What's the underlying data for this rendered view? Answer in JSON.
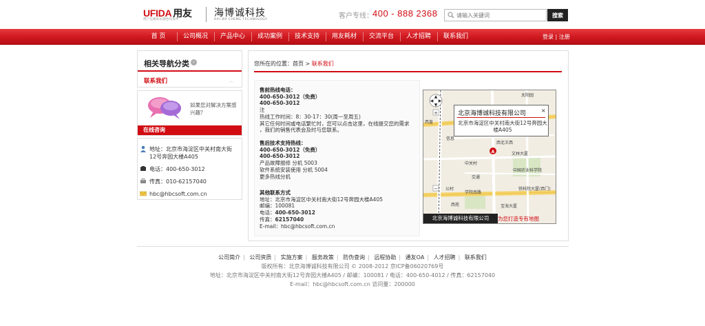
{
  "header": {
    "ufida_brand": "UFIDA",
    "ufida_cn": "用友",
    "ufida_slogan": "用户信赖的长期合作伙伴",
    "hbc_name": "海博诚科技",
    "hbc_sub": "HAI BO CHENG TECHNOLOGY",
    "hotline_label": "客户专线：",
    "hotline_number": "400 - 888 2368",
    "search_placeholder": "请输入关键词",
    "search_button": "搜索"
  },
  "nav": {
    "items": [
      "首 页",
      "公司概况",
      "产品中心",
      "成功案例",
      "技术支持",
      "用友耗材",
      "交流平台",
      "人才招聘",
      "联系我们"
    ],
    "login": "登录",
    "register": "注册"
  },
  "sidebar": {
    "title": "相关导航分类",
    "item": "联系我们",
    "consult_text": "如果您对解决方案感兴趣？",
    "consult_bar": "在线咨询",
    "contact": {
      "address": "地址：北京市海淀区中关村南大街",
      "address2": "12号奔园大楼A405",
      "phone": "电话：400-650-3012",
      "fax": "传真：010-62157040",
      "email": "hbc@hbcsoft.com.cn"
    }
  },
  "main": {
    "breadcrumb_prefix": "您所在的位置：",
    "breadcrumb_home": "首页",
    "breadcrumb_sep": ">",
    "breadcrumb_current": "联系我们",
    "presales": {
      "title": "售前热线电话：",
      "line1": "400-650-3012（免费）",
      "line2": "400-650-3012",
      "line3": "注",
      "line4": "热线工作时间：8：30-17：30(周一至周五)",
      "line5": "其它任何时间或电话繁忙时，您可以点击这里，在线提交您的需求",
      "line6": "，我们的销售代表会及时与您联系。"
    },
    "aftersales": {
      "title": "售后技术支持热线：",
      "line1": "400-650-3012（免费）",
      "line2": "400-650-3012",
      "line3": "产品故障报修 分机 5003",
      "line4": "软件系统安装使用 分机 5004",
      "line5": "更多热线分机"
    },
    "other": {
      "title": "其他联系方式",
      "address": "地址：北京市海淀区中关村南大街12号奔园大楼A405",
      "postcode_label": "邮编：",
      "postcode": "100081",
      "phone_label": "电话：",
      "phone": "400-650-3012",
      "fax_label": "传真：",
      "fax": "62157040",
      "email": "E-mail：hbc@hbcsoft.com.cn"
    },
    "map": {
      "popup_title": "北京海博诚科技有限公司",
      "popup_close": "×",
      "popup_address": "北京市海淀区中关村南大街12号奔园大楼A405",
      "bottom_label": "北京海博诚科技有限公司",
      "promo": "为您打造专有地图",
      "places": {
        "taiyangyuan": "太阳园",
        "xizhimen": "西直",
        "xinxin": "信息",
        "xibeiwangxi": "西北王西",
        "wenlin": "文林大厦",
        "physics": "中国农业科学院",
        "railway": "铁科院大厦(西门)",
        "business": "学院南路",
        "gongfen": "公村",
        "haoshang": "宝海大厦",
        "xiyuan": "西苑",
        "zhongguo": "中关村",
        "jiaotong": "交通"
      }
    }
  },
  "footer": {
    "links": [
      "公司简介",
      "公司资质",
      "实施方案",
      "服务政策",
      "防伪查询",
      "远程协助",
      "通友OA",
      "人才招聘",
      "联系我们"
    ],
    "copyright": "版权所有：北京海博诚科技有限公司 © 2008-2012 京ICP备06020769号",
    "address": "地址：北京市海淀区中关村南大街12号奔园大楼A405 / 邮编：100081 / 电话：400-650-4012 / 传真：62157040",
    "email": "E-mail：hbc@hbcsoft.com.cn 访问量：200000"
  },
  "colors": {
    "brand_red": "#d10c13",
    "nav_red": "#d11a21",
    "dark": "#222222"
  }
}
